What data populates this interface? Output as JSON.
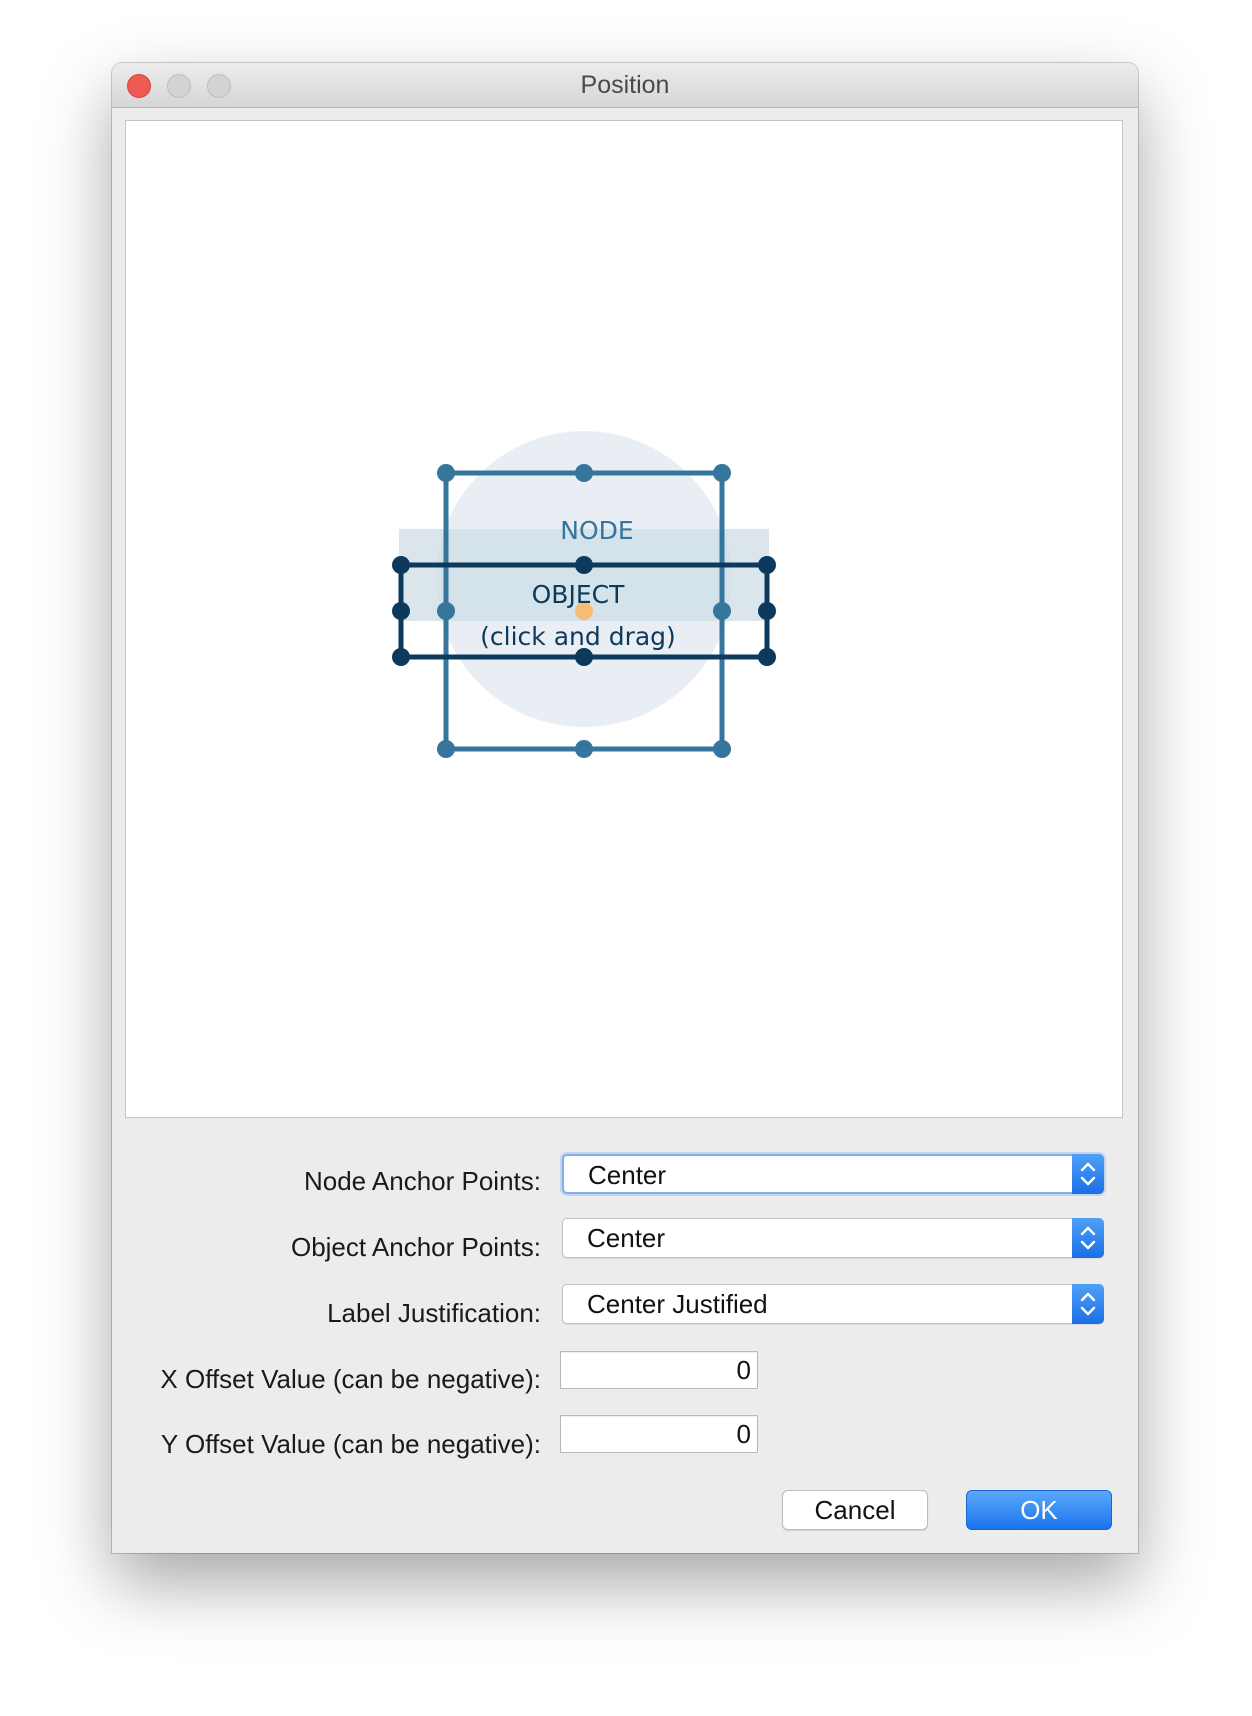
{
  "window": {
    "title": "Position"
  },
  "preview": {
    "node_label": "NODE",
    "object_label_line1": "OBJECT",
    "object_label_line2": "(click and drag)",
    "colors": {
      "node_frame": "#36759c",
      "object_frame": "#0d3a5c",
      "node_fill": "#e8eef3",
      "object_fill": "#cddde6",
      "anchor_marker": "#f6bb74"
    }
  },
  "form": {
    "node_anchor": {
      "label": "Node Anchor Points:",
      "value": "Center"
    },
    "object_anchor": {
      "label": "Object Anchor Points:",
      "value": "Center"
    },
    "label_justification": {
      "label": "Label Justification:",
      "value": "Center Justified"
    },
    "x_offset": {
      "label": "X Offset Value (can be negative):",
      "value": "0"
    },
    "y_offset": {
      "label": "Y Offset Value (can be negative):",
      "value": "0"
    }
  },
  "buttons": {
    "cancel": "Cancel",
    "ok": "OK"
  }
}
